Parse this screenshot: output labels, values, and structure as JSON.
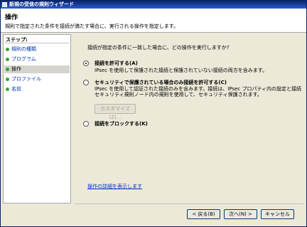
{
  "window": {
    "title": "新規の受信の規則ウィザード"
  },
  "header": {
    "title": "操作",
    "description": "規則で指定された条件を接続が満たす場合に、実行される操作を指定します。"
  },
  "steps": {
    "title": "ステップ:",
    "items": [
      {
        "label": "規則の種類",
        "active": false
      },
      {
        "label": "プログラム",
        "active": false
      },
      {
        "label": "操作",
        "active": true
      },
      {
        "label": "プロファイル",
        "active": false
      },
      {
        "label": "名前",
        "active": false
      }
    ]
  },
  "main": {
    "question": "接続が指定の条件に一致した場合に、どの操作を実行しますか?",
    "options": [
      {
        "title": "接続を許可する(A)",
        "desc1": "IPsec を使用して保護された接続と保護されていない接続の両方を含みます。",
        "desc2": "",
        "desc3": "",
        "selected": true
      },
      {
        "title": "セキュリティで保護されている場合のみ接続を許可する(C)",
        "desc1": "IPsec を使用して認証された接続のみを含みます。接続は、IPsec プロパティ内の設定と接続",
        "desc2": "セキュリティ規則ノード内の規則を使用して、セキュリティ保護されます。",
        "desc3": "",
        "selected": false
      },
      {
        "title": "接続をブロックする(K)",
        "desc1": "",
        "desc2": "",
        "desc3": "",
        "selected": false
      }
    ],
    "customize_label": "カスタマイズ(Z)...",
    "details_link": "操作の詳細を表示します"
  },
  "footer": {
    "back_label": "< 戻る(B)",
    "next_label": "次へ(N) >",
    "cancel_label": "キャンセル"
  }
}
